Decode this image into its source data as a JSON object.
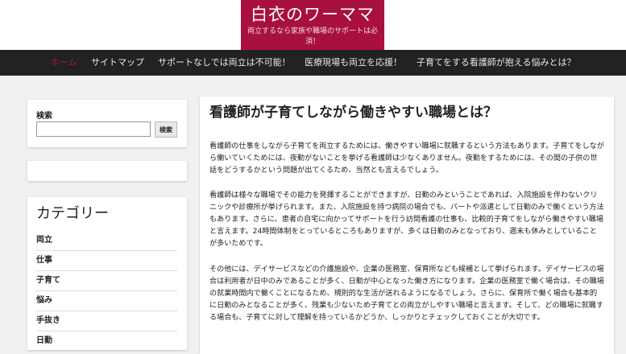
{
  "site": {
    "title": "白衣のワーママ",
    "description": "両立するなら家族や職場のサポートは必須！"
  },
  "nav": {
    "items": [
      {
        "label": "ホーム",
        "active": true
      },
      {
        "label": "サイトマップ"
      },
      {
        "label": "サポートなしでは両立は不可能！"
      },
      {
        "label": "医療現場も両立を応援！"
      },
      {
        "label": "子育てをする看護師が抱える悩みとは？"
      }
    ]
  },
  "sidebar": {
    "search": {
      "title": "検索",
      "placeholder": "",
      "button_label": "検索"
    },
    "categories": {
      "title": "カテゴリー",
      "items": [
        {
          "label": "両立"
        },
        {
          "label": "仕事"
        },
        {
          "label": "子育て"
        },
        {
          "label": "悩み"
        },
        {
          "label": "手抜き"
        },
        {
          "label": "日勤"
        }
      ]
    }
  },
  "article": {
    "title": "看護師が子育てしながら働きやすい職場とは？",
    "paragraphs": [
      "看護師の仕事をしながら子育てを両立するためには、働きやすい職場に就職するという方法もあります。子育てをしながら働いていくためには、夜勤がないことを挙げる看護師は少なくありません。夜勤をするためには、その間の子供の世話をどうするかという問題が出てくるため、当然とも言えるでしょう。",
      "看護師は様々な職場でその能力を発揮することができますが、日勤のみということであれば、入院施設を伴わないクリニックや診療所が挙げられます。また、入院施設を持つ病院の場合でも、パートや派遣として日勤のみで働くという方法もあります。さらに、患者の自宅に向かってサポートを行う訪問看護の仕事も、比較的子育てをしながら働きやすい職場と言えます。24時間体制をとっているところもありますが、多くは日勤のみとなっており、週末も休みとしていることが多いためです。",
      "その他には、デイサービスなどの介護施設や、企業の医務室、保育所なども候補として挙げられます。デイサービスの場合は利用者が日中のみであることが多く、日勤が中心となった働き方になります。企業の医務室で働く場合は、その職場の就業時間内で働くことになるため、規則的な生活が送れるようになるでしょう。さらに、保育所で働く場合も基本的に日勤のみとなることが多く、残業も少ないため子育てとの両立がしやすい職場と言えます。そして、どの職場に就職する場合も、子育てに対して理解を持っているかどうか、しっかりとチェックしておくことが大切です。"
    ]
  },
  "colors": {
    "accent": "#a8103f",
    "nav_background": "#222222",
    "page_background": "#f1f1f1"
  }
}
